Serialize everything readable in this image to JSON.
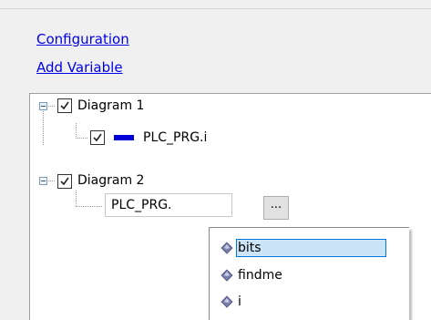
{
  "links": {
    "configuration": "Configuration",
    "add_variable": "Add Variable"
  },
  "tree": {
    "diagram1": {
      "label": "Diagram 1",
      "checked": true,
      "variable": {
        "label": "PLC_PRG.i",
        "checked": true,
        "color": "#0000d8"
      }
    },
    "diagram2": {
      "label": "Diagram 2",
      "checked": true,
      "variable_input": {
        "value": "PLC_PRG."
      },
      "browse_button_label": "..."
    }
  },
  "autocomplete": {
    "items": [
      {
        "label": "bits",
        "icon": "variable-icon",
        "selected": true
      },
      {
        "label": "findme",
        "icon": "variable-icon",
        "selected": false
      },
      {
        "label": "i",
        "icon": "variable-icon",
        "selected": false
      }
    ]
  }
}
